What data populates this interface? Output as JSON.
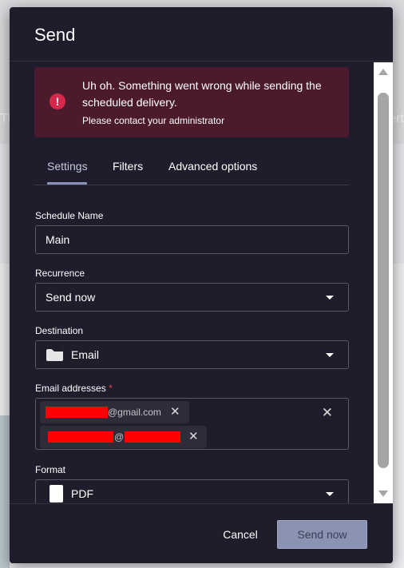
{
  "background": {
    "left_fragment": "Th",
    "right_fragment": "ert"
  },
  "dialog": {
    "title": "Send"
  },
  "alert": {
    "title": "Uh oh. Something went wrong while sending the scheduled delivery.",
    "message": "Please contact your administrator",
    "icon": "error-icon"
  },
  "tabs": [
    {
      "label": "Settings",
      "active": true
    },
    {
      "label": "Filters",
      "active": false
    },
    {
      "label": "Advanced options",
      "active": false
    }
  ],
  "form": {
    "schedule_name": {
      "label": "Schedule Name",
      "value": "Main"
    },
    "recurrence": {
      "label": "Recurrence",
      "value": "Send now"
    },
    "destination": {
      "label": "Destination",
      "value": "Email",
      "icon": "mail-icon"
    },
    "email_addresses": {
      "label": "Email addresses",
      "required_marker": "*",
      "chips": [
        {
          "visible_text": "@gmail.com"
        },
        {
          "visible_text": "@"
        }
      ]
    },
    "format": {
      "label": "Format",
      "value": "PDF",
      "icon": "pdf-icon"
    }
  },
  "footer": {
    "cancel_label": "Cancel",
    "send_label": "Send now"
  },
  "colors": {
    "dialog_bg": "#1f1c2b",
    "alert_bg": "#4b1a2c",
    "alert_icon": "#d6284a",
    "primary_button": "#8a93b4",
    "tab_indicator": "#8a93bb"
  }
}
